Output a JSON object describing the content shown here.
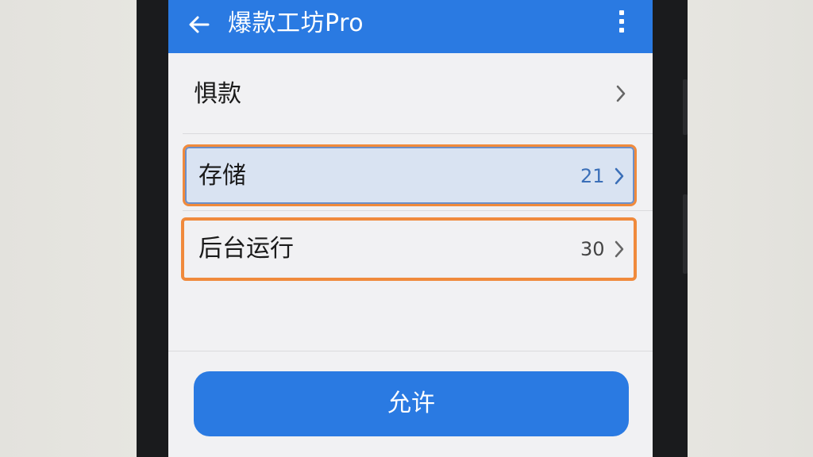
{
  "app": {
    "title": "爆款工坊Pro"
  },
  "rows": [
    {
      "label": "惧款",
      "count": ""
    },
    {
      "label": "存储",
      "count": "21"
    },
    {
      "label": "后台运行",
      "count": "30"
    }
  ],
  "actions": {
    "allow_label": "允许"
  },
  "colors": {
    "primary": "#2a7ae2",
    "highlight": "#f08a3c",
    "count_blue": "#3b6fb8"
  },
  "icons": {
    "back": "arrow-left-icon",
    "more": "more-vertical-icon",
    "chevron": "chevron-right-icon"
  }
}
